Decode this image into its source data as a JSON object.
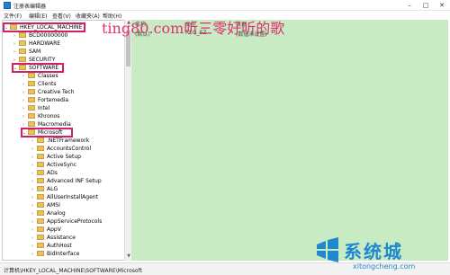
{
  "window": {
    "title": "注册表编辑器",
    "controls": [
      "–",
      "□",
      "✕"
    ]
  },
  "menu": [
    "文件(F)",
    "编辑(E)",
    "查看(V)",
    "收藏夹(A)",
    "帮助(H)"
  ],
  "watermark": "ting80.com听三零好听的歌",
  "tree": [
    {
      "label": "HKEY_LOCAL_MACHINE",
      "level": 1,
      "expanded": true,
      "highlight": true
    },
    {
      "label": "BCD00000000",
      "level": 2,
      "expanded": false
    },
    {
      "label": "HARDWARE",
      "level": 2,
      "expanded": false
    },
    {
      "label": "SAM",
      "level": 2,
      "expanded": false
    },
    {
      "label": "SECURITY",
      "level": 2,
      "expanded": false
    },
    {
      "label": "SOFTWARE",
      "level": 2,
      "expanded": true,
      "highlight": true
    },
    {
      "label": "Classes",
      "level": 3,
      "expanded": false
    },
    {
      "label": "Clients",
      "level": 3,
      "expanded": false
    },
    {
      "label": "Creative Tech",
      "level": 3,
      "expanded": false
    },
    {
      "label": "Fortemedia",
      "level": 3,
      "expanded": false
    },
    {
      "label": "Intel",
      "level": 3,
      "expanded": false
    },
    {
      "label": "Khronos",
      "level": 3,
      "expanded": false
    },
    {
      "label": "Macromedia",
      "level": 3,
      "expanded": false
    },
    {
      "label": "Microsoft",
      "level": 3,
      "expanded": true,
      "highlight": true
    },
    {
      "label": ".NETFramework",
      "level": 4,
      "expanded": false
    },
    {
      "label": "AccountsControl",
      "level": 4,
      "expanded": false
    },
    {
      "label": "Active Setup",
      "level": 4,
      "expanded": false
    },
    {
      "label": "ActiveSync",
      "level": 4,
      "expanded": false
    },
    {
      "label": "ADs",
      "level": 4,
      "expanded": false
    },
    {
      "label": "Advanced INF Setup",
      "level": 4,
      "expanded": false
    },
    {
      "label": "ALG",
      "level": 4,
      "expanded": false
    },
    {
      "label": "AllUserInstallAgent",
      "level": 4,
      "expanded": false
    },
    {
      "label": "AMSI",
      "level": 4,
      "expanded": false
    },
    {
      "label": "Analog",
      "level": 4,
      "expanded": false
    },
    {
      "label": "AppServiceProtocols",
      "level": 4,
      "expanded": false
    },
    {
      "label": "AppV",
      "level": 4,
      "expanded": false
    },
    {
      "label": "Assistance",
      "level": 4,
      "expanded": false
    },
    {
      "label": "AuthHost",
      "level": 4,
      "expanded": false
    },
    {
      "label": "BidInterface",
      "level": 4,
      "expanded": false
    }
  ],
  "list": {
    "columns": [
      "名称",
      "类型",
      "数据"
    ],
    "rows": [
      {
        "name": "(默认)",
        "type": "REG_SZ",
        "data": "(数值未设置)"
      }
    ]
  },
  "status": {
    "path": "计算机\\HKEY_LOCAL_MACHINE\\SOFTWARE\\Microsoft"
  },
  "logo": {
    "cn": "系统城",
    "en": "xitongcheng.com"
  },
  "colors": {
    "highlight": "#d21f6a",
    "right_panel_bg": "#c8ebc4",
    "logo_blue": "#1e88d0"
  }
}
